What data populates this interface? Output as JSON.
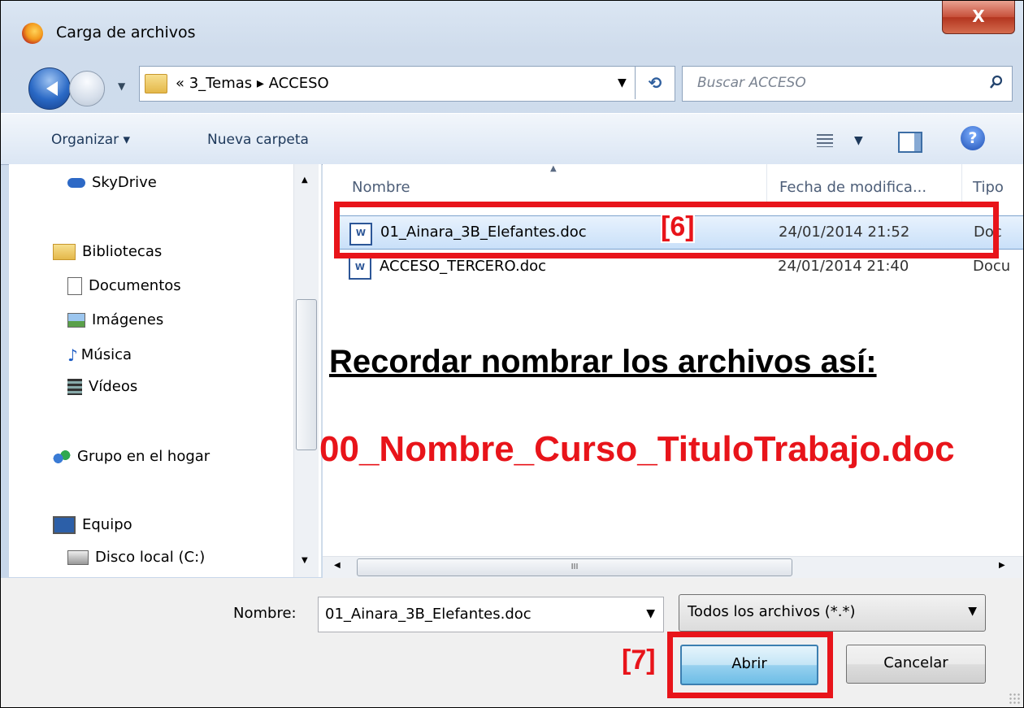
{
  "window": {
    "title": "Carga de archivos",
    "close_label": "X"
  },
  "address": {
    "path": "« 3_Temas ▸ ACCESO",
    "refresh_label": "⟲"
  },
  "search": {
    "placeholder": "Buscar ACCESO"
  },
  "toolbar": {
    "organize_label": "Organizar ▾",
    "new_folder_label": "Nueva carpeta"
  },
  "sidebar": {
    "items": [
      {
        "label": "SkyDrive"
      },
      {
        "label": "Bibliotecas"
      },
      {
        "label": "Documentos"
      },
      {
        "label": "Imágenes"
      },
      {
        "label": "Música"
      },
      {
        "label": "Vídeos"
      },
      {
        "label": "Grupo en el hogar"
      },
      {
        "label": "Equipo"
      },
      {
        "label": "Disco local (C:)"
      }
    ]
  },
  "columns": {
    "name": "Nombre",
    "date": "Fecha de modifica...",
    "type": "Tipo"
  },
  "files": [
    {
      "name": "01_Ainara_3B_Elefantes.doc",
      "date": "24/01/2014 21:52",
      "type": "Doc"
    },
    {
      "name": "ACCESO_TERCERO.doc",
      "date": "24/01/2014 21:40",
      "type": "Docu"
    }
  ],
  "annotations": {
    "step6": "[6]",
    "step7": "[7]",
    "note_heading": "Recordar nombrar los archivos así:",
    "note_pattern": "00_Nombre_Curso_TituloTrabajo.doc"
  },
  "hscroll_label": "III",
  "bottom": {
    "filename_label": "Nombre:",
    "filename_value": "01_Ainara_3B_Elefantes.doc",
    "filter_value": "Todos los archivos (*.*)",
    "open_label": "Abrir",
    "cancel_label": "Cancelar"
  },
  "colors": {
    "accent_red": "#e8141a",
    "selection": "#c9e0f9"
  }
}
